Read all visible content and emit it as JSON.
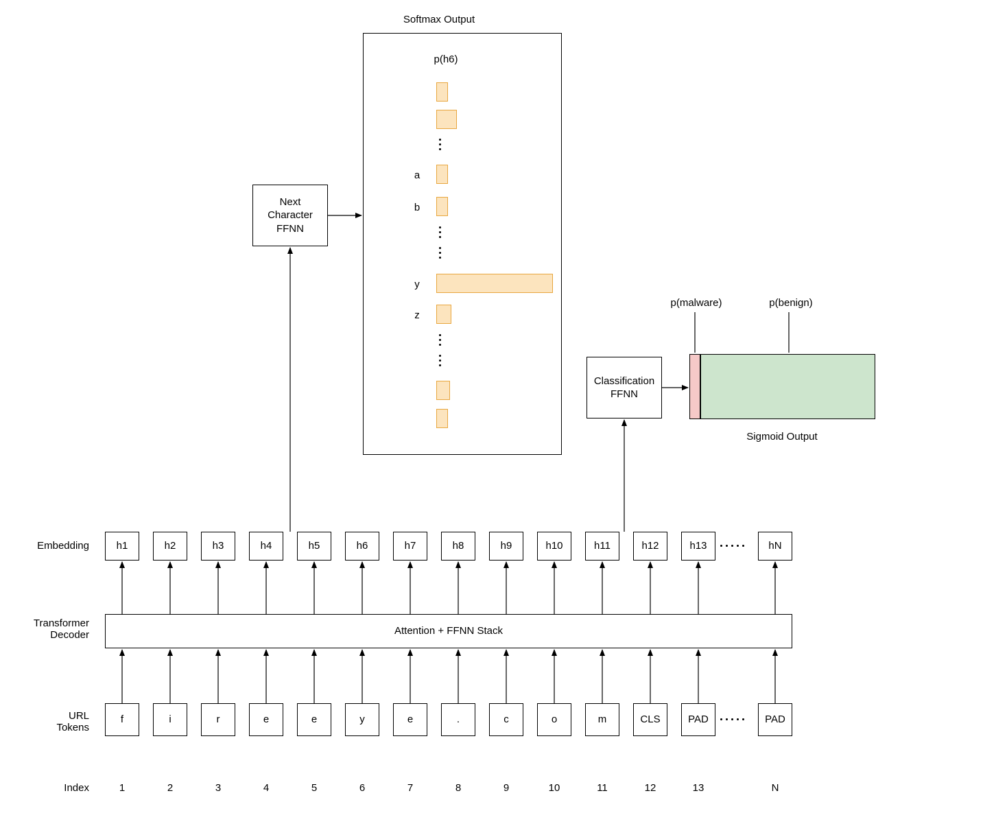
{
  "headings": {
    "softmax_output": "Softmax Output",
    "sigmoid_output": "Sigmoid Output",
    "embedding": "Embedding",
    "transformer_decoder": "Transformer\nDecoder",
    "url_tokens": "URL\nTokens",
    "index": "Index"
  },
  "blocks": {
    "next_char_ffnn": "Next\nCharacter\nFFNN",
    "classification_ffnn": "Classification\nFFNN",
    "attention_stack": "Attention + FFNN Stack"
  },
  "softmax": {
    "title": "p(h6)",
    "row_a": "a",
    "row_b": "b",
    "row_y": "y",
    "row_z": "z"
  },
  "sigmoid": {
    "p_malware": "p(malware)",
    "p_benign": "p(benign)"
  },
  "embeddings": [
    "h1",
    "h2",
    "h3",
    "h4",
    "h5",
    "h6",
    "h7",
    "h8",
    "h9",
    "h10",
    "h11",
    "h12",
    "h13",
    "hN"
  ],
  "url_tokens": [
    "f",
    "i",
    "r",
    "e",
    "e",
    "y",
    "e",
    ".",
    "c",
    "o",
    "m",
    "CLS",
    "PAD",
    "PAD"
  ],
  "indices": [
    "1",
    "2",
    "3",
    "4",
    "5",
    "6",
    "7",
    "8",
    "9",
    "10",
    "11",
    "12",
    "13",
    "N"
  ]
}
